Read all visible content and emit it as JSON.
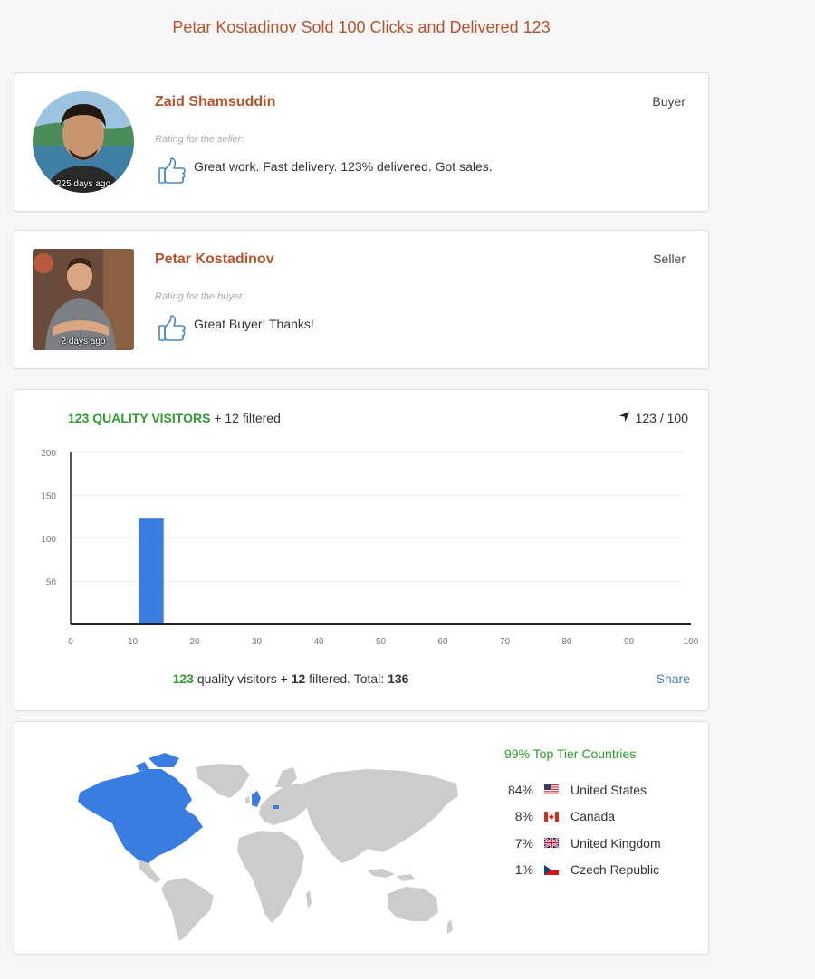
{
  "page": {
    "title": "Petar Kostadinov Sold 100 Clicks and Delivered 123"
  },
  "reviews": [
    {
      "name": "Zaid Shamsuddin",
      "role": "Buyer",
      "ago": "225 days ago",
      "sub": "Rating for the seller:",
      "text": "Great work. Fast delivery. 123% delivered. Got sales."
    },
    {
      "name": "Petar Kostadinov",
      "role": "Seller",
      "ago": "2 days ago",
      "sub": "Rating for the buyer:",
      "text": "Great Buyer! Thanks!"
    }
  ],
  "stats": {
    "quality_label": "123 QUALITY VISITORS",
    "filtered_label": "+ 12 filtered",
    "count_label": "123 / 100",
    "footer": {
      "quality": "123",
      "quality_text": "quality visitors +",
      "filtered": "12",
      "filtered_text": "filtered. Total:",
      "total": "136"
    },
    "share_label": "Share"
  },
  "chart_data": {
    "type": "bar",
    "x_ticks": [
      0,
      10,
      20,
      30,
      40,
      50,
      60,
      70,
      80,
      90,
      100
    ],
    "y_ticks": [
      50,
      100,
      150,
      200
    ],
    "xlim": [
      0,
      100
    ],
    "ylim": [
      0,
      200
    ],
    "bars": [
      {
        "x_start": 11,
        "x_end": 15,
        "value": 123
      }
    ],
    "color": "#3a7de0",
    "grid": true
  },
  "geo": {
    "title": "99% Top Tier Countries",
    "countries": [
      {
        "pct": "84%",
        "name": "United States",
        "flag": "us-flag-icon"
      },
      {
        "pct": "8%",
        "name": "Canada",
        "flag": "ca-flag-icon"
      },
      {
        "pct": "7%",
        "name": "United Kingdom",
        "flag": "gb-flag-icon"
      },
      {
        "pct": "1%",
        "name": "Czech Republic",
        "flag": "cz-flag-icon"
      }
    ],
    "highlight_color": "#3a7de0",
    "base_color": "#cccccc"
  },
  "icons": {
    "thumb": "thumbs-up-icon",
    "count": "location-arrow-icon"
  }
}
